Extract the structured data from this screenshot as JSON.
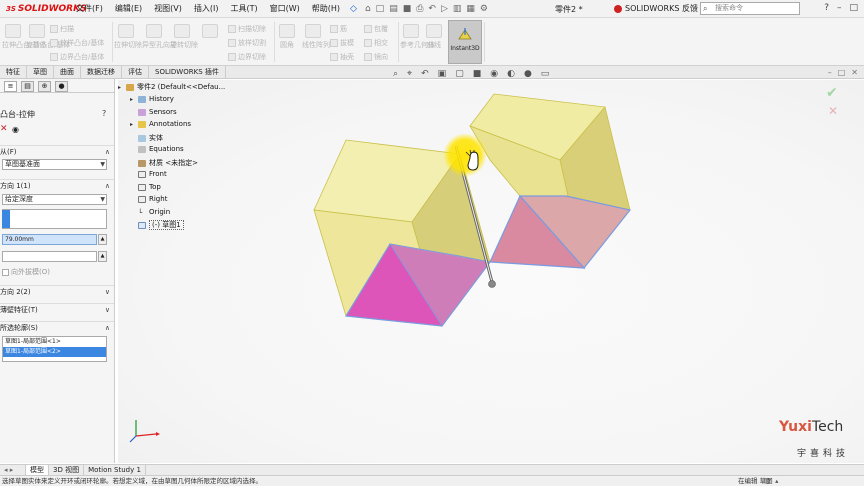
{
  "app": {
    "logo": "SOLIDWORKS",
    "menus": [
      "文件(F)",
      "编辑(E)",
      "视图(V)",
      "插入(I)",
      "工具(T)",
      "窗口(W)",
      "帮助(H)"
    ],
    "document_title": "零件2 *",
    "feedback": "SOLIDWORKS 反馈",
    "search_placeholder": "搜索命令"
  },
  "ribbon": {
    "buttons": [
      "拉伸凸台/基体",
      "旋转凸台/基体",
      "拉伸切除",
      "异型孔向导",
      "旋转切除",
      "圆角",
      "线性阵列",
      "拔模",
      "包覆",
      "参考几何体",
      "曲线",
      "Instant3D"
    ],
    "small_buttons": [
      "扫描",
      "放样凸台/基体",
      "边界凸台/基体",
      "扫描切除",
      "放样切割",
      "边界切除",
      "抽壳",
      "筋",
      "相交",
      "镜向"
    ],
    "active": "Instant3D"
  },
  "command_tabs": [
    "特征",
    "草图",
    "曲面",
    "数据迁移",
    "评估",
    "SOLIDWORKS 插件"
  ],
  "property_manager": {
    "title": "凸台-拉伸",
    "help": "?",
    "from_label": "从(F)",
    "from_value": "草图基准面",
    "direction1_label": "方向 1(1)",
    "end_condition": "给定深度",
    "depth": "79.00mm",
    "draft_label": "向外拔模(O)",
    "direction2_label": "方向 2(2)",
    "thin_label": "薄壁特征(T)",
    "contour_label": "所选轮廓(S)",
    "contours": [
      "草图1-局部范围<1>",
      "草图1-局部范围<2>"
    ]
  },
  "feature_tree": {
    "root": "零件2  (Default<<Defau...",
    "nodes": [
      "History",
      "Sensors",
      "Annotations",
      "实体",
      "Equations",
      "材质 <未指定>",
      "Front",
      "Top",
      "Right",
      "Origin",
      "(-) 草图1"
    ]
  },
  "bottom_tabs": [
    "模型",
    "3D 视图",
    "Motion Study 1"
  ],
  "status": {
    "message": "选择草图实体来定义开环或闭环轮廓。若想定义域，在由草图几何体所限定的区域内选择。",
    "mode": "在编辑 草图"
  },
  "watermark": {
    "brand_accent": "Yuxi",
    "brand_rest": "Tech",
    "cn": "宇喜科技"
  },
  "colors": {
    "accent_red": "#d11111",
    "selection_blue": "#3a86e0",
    "preview_yellow": "#ece46c",
    "preview_magenta": "#d860b8"
  }
}
